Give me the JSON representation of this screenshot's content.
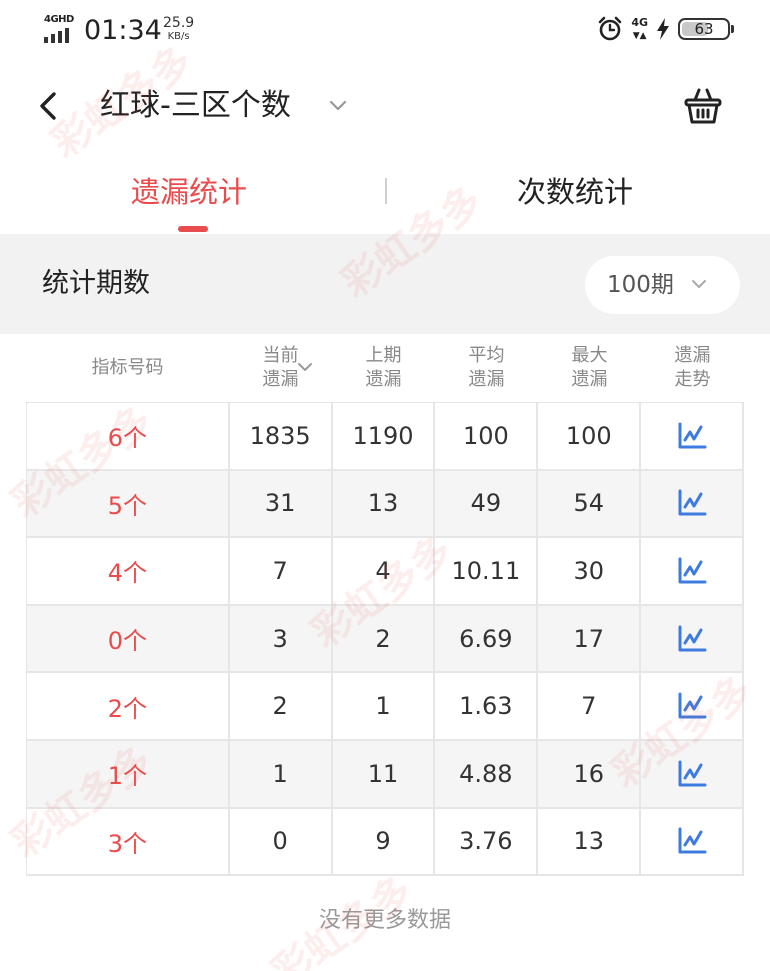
{
  "status_bar": {
    "network_label": "4GHD",
    "time": "01:34",
    "speed_value": "25.9",
    "speed_unit": "KB/s",
    "secondary_network": "4G",
    "battery": "63",
    "battery_level": 0.63
  },
  "header": {
    "title": "红球-三区个数"
  },
  "tabs": [
    {
      "label": "遗漏统计",
      "active": true
    },
    {
      "label": "次数统计",
      "active": false
    }
  ],
  "period": {
    "label": "统计期数",
    "value": "100期"
  },
  "table": {
    "headers": [
      {
        "line1": "指标号码",
        "line2": ""
      },
      {
        "line1": "当前",
        "line2": "遗漏"
      },
      {
        "line1": "上期",
        "line2": "遗漏"
      },
      {
        "line1": "平均",
        "line2": "遗漏"
      },
      {
        "line1": "最大",
        "line2": "遗漏"
      },
      {
        "line1": "遗漏",
        "line2": "走势"
      }
    ],
    "rows": [
      {
        "label": "6个",
        "current": "1835",
        "previous": "1190",
        "average": "100",
        "max": "100"
      },
      {
        "label": "5个",
        "current": "31",
        "previous": "13",
        "average": "49",
        "max": "54"
      },
      {
        "label": "4个",
        "current": "7",
        "previous": "4",
        "average": "10.11",
        "max": "30"
      },
      {
        "label": "0个",
        "current": "3",
        "previous": "2",
        "average": "6.69",
        "max": "17"
      },
      {
        "label": "2个",
        "current": "2",
        "previous": "1",
        "average": "1.63",
        "max": "7"
      },
      {
        "label": "1个",
        "current": "1",
        "previous": "11",
        "average": "4.88",
        "max": "16"
      },
      {
        "label": "3个",
        "current": "0",
        "previous": "9",
        "average": "3.76",
        "max": "13"
      }
    ]
  },
  "footer": {
    "no_more": "没有更多数据"
  },
  "watermark": "彩虹多多",
  "colors": {
    "accent": "#e84c4c",
    "icon_blue": "#3e7be0"
  }
}
